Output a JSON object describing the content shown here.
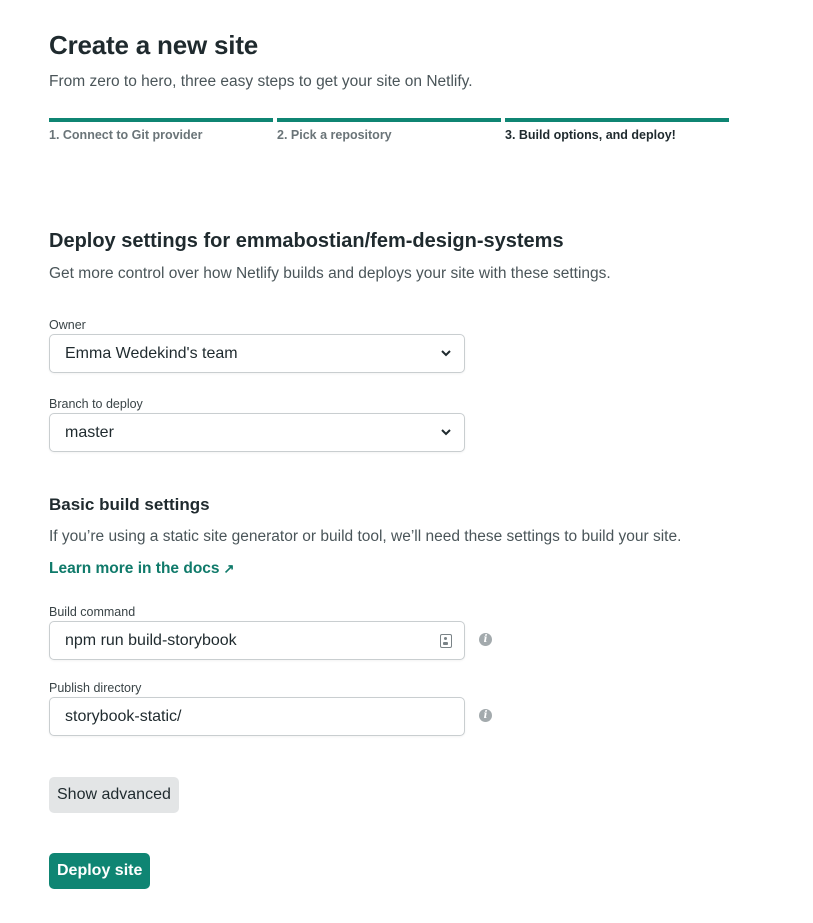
{
  "header": {
    "title": "Create a new site",
    "subtitle": "From zero to hero, three easy steps to get your site on Netlify."
  },
  "steps": [
    {
      "label": "1. Connect to Git provider"
    },
    {
      "label": "2. Pick a repository"
    },
    {
      "label": "3. Build options, and deploy!"
    }
  ],
  "deploy_settings": {
    "title": "Deploy settings for emmabostian/fem-design-systems",
    "description": "Get more control over how Netlify builds and deploys your site with these settings.",
    "owner": {
      "label": "Owner",
      "value": "Emma Wedekind's team"
    },
    "branch": {
      "label": "Branch to deploy",
      "value": "master"
    }
  },
  "build_settings": {
    "title": "Basic build settings",
    "description": "If you’re using a static site generator or build tool, we’ll need these settings to build your site.",
    "docs_link": "Learn more in the docs",
    "build_command": {
      "label": "Build command",
      "value": "npm run build-storybook"
    },
    "publish_directory": {
      "label": "Publish directory",
      "value": "storybook-static/"
    }
  },
  "buttons": {
    "show_advanced": "Show advanced",
    "deploy": "Deploy site"
  },
  "colors": {
    "accent": "#0f8573",
    "link": "#0f7a6a",
    "secondary_button": "#e3e5e6"
  },
  "icons": [
    "chevron-down-icon",
    "id-card-icon",
    "info-icon",
    "external-arrow-icon"
  ]
}
